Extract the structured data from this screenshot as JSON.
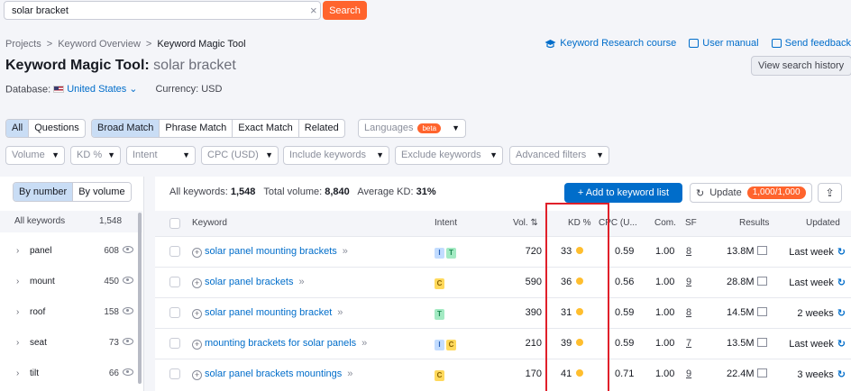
{
  "search": {
    "value": "solar bracket",
    "clear_icon": "close-icon",
    "button": "Search"
  },
  "breadcrumb": {
    "items": [
      "Projects",
      "Keyword Overview",
      "Keyword Magic Tool"
    ],
    "separator": ">"
  },
  "links": {
    "course": "Keyword Research course",
    "manual": "User manual",
    "feedback": "Send feedback"
  },
  "title": {
    "main": "Keyword Magic Tool:",
    "keyword": "solar bracket"
  },
  "view_history": "View search history",
  "database": {
    "label": "Database:",
    "value": "United States",
    "currency": "Currency: USD"
  },
  "match_tabs": {
    "group1": [
      "All",
      "Questions"
    ],
    "group2": [
      "Broad Match",
      "Phrase Match",
      "Exact Match",
      "Related"
    ],
    "active1": "All",
    "active2": "Broad Match"
  },
  "languages": {
    "label": "Languages",
    "beta": "beta"
  },
  "filters": [
    "Volume",
    "KD %",
    "Intent",
    "CPC (USD)",
    "Include keywords",
    "Exclude keywords",
    "Advanced filters"
  ],
  "left_panel": {
    "toggle": [
      "By number",
      "By volume"
    ],
    "header": {
      "label": "All keywords",
      "count": "1,548"
    },
    "groups": [
      {
        "name": "panel",
        "count": "608"
      },
      {
        "name": "mount",
        "count": "450"
      },
      {
        "name": "roof",
        "count": "158"
      },
      {
        "name": "seat",
        "count": "73"
      },
      {
        "name": "tilt",
        "count": "66"
      }
    ]
  },
  "summary": {
    "all_label": "All keywords:",
    "all_value": "1,548",
    "vol_label": "Total volume:",
    "vol_value": "8,840",
    "kd_label": "Average KD:",
    "kd_value": "31%"
  },
  "actions": {
    "add": "+ Add to keyword list",
    "update": "Update",
    "quota": "1,000/1,000",
    "export_icon": "export-icon"
  },
  "columns": {
    "keyword": "Keyword",
    "intent": "Intent",
    "volume": "Vol.",
    "kd": "KD %",
    "cpc": "CPC (U...",
    "com": "Com.",
    "sf": "SF",
    "results": "Results",
    "updated": "Updated"
  },
  "rows": [
    {
      "keyword": "solar panel mounting brackets",
      "intent": [
        "I",
        "T"
      ],
      "volume": "720",
      "kd": "33",
      "cpc": "0.59",
      "com": "1.00",
      "sf": "8",
      "results": "13.8M",
      "updated": "Last week"
    },
    {
      "keyword": "solar panel brackets",
      "intent": [
        "C"
      ],
      "volume": "590",
      "kd": "36",
      "cpc": "0.56",
      "com": "1.00",
      "sf": "9",
      "results": "28.8M",
      "updated": "Last week"
    },
    {
      "keyword": "solar panel mounting bracket",
      "intent": [
        "T"
      ],
      "volume": "390",
      "kd": "31",
      "cpc": "0.59",
      "com": "1.00",
      "sf": "8",
      "results": "14.5M",
      "updated": "2 weeks"
    },
    {
      "keyword": "mounting brackets for solar panels",
      "intent": [
        "I",
        "C"
      ],
      "volume": "210",
      "kd": "39",
      "cpc": "0.59",
      "com": "1.00",
      "sf": "7",
      "results": "13.5M",
      "updated": "Last week"
    },
    {
      "keyword": "solar panel brackets mountings",
      "intent": [
        "C"
      ],
      "volume": "170",
      "kd": "41",
      "cpc": "0.71",
      "com": "1.00",
      "sf": "9",
      "results": "22.4M",
      "updated": "3 weeks"
    }
  ],
  "colors": {
    "accent": "#006dca",
    "orange": "#ff642d",
    "highlight": "#e0202a",
    "kd_dot": "#ffbe2e"
  }
}
